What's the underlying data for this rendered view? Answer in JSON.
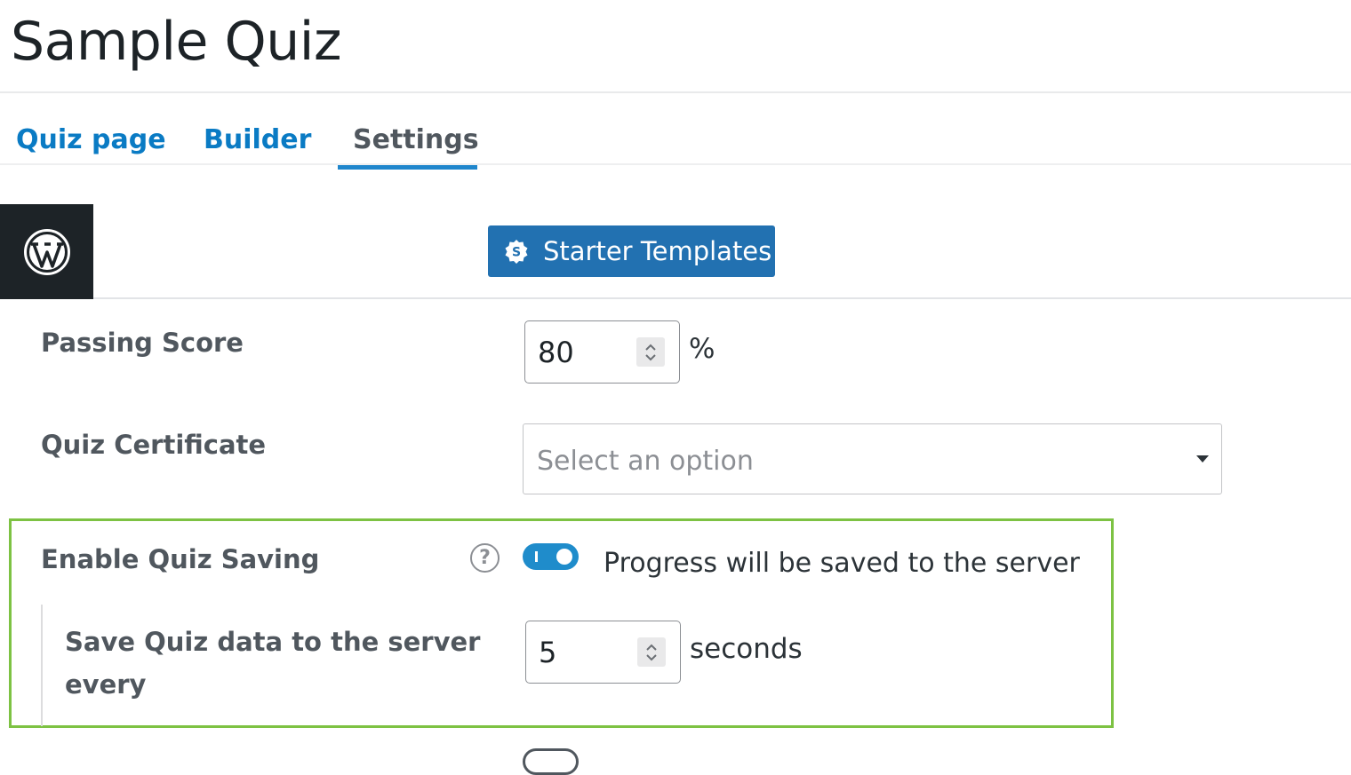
{
  "page": {
    "title": "Sample Quiz"
  },
  "tabs": [
    {
      "label": "Quiz page",
      "active": false
    },
    {
      "label": "Builder",
      "active": false
    },
    {
      "label": "Settings",
      "active": true
    }
  ],
  "toolbar": {
    "starter_templates_label": "Starter Templates",
    "wp_logo_icon": "wordpress-logo-icon",
    "starter_icon": "starter-templates-icon"
  },
  "settings": {
    "passing_score": {
      "label": "Passing Score",
      "value": "80",
      "suffix": "%"
    },
    "quiz_certificate": {
      "label": "Quiz Certificate",
      "placeholder": "Select an option"
    },
    "enable_quiz_saving": {
      "label": "Enable Quiz Saving",
      "help_icon": "help-circle-icon",
      "enabled": true,
      "status_text": "Progress will be saved to the server"
    },
    "save_interval": {
      "label_line1": "Save Quiz data to the server",
      "label_line2": "every",
      "value": "5",
      "suffix": "seconds"
    }
  },
  "colors": {
    "tab_link": "#0a7bc4",
    "tab_active": "#50575e",
    "button_primary": "#2271b1",
    "toggle_on": "#1f8ccb",
    "highlight": "#7dc243"
  }
}
